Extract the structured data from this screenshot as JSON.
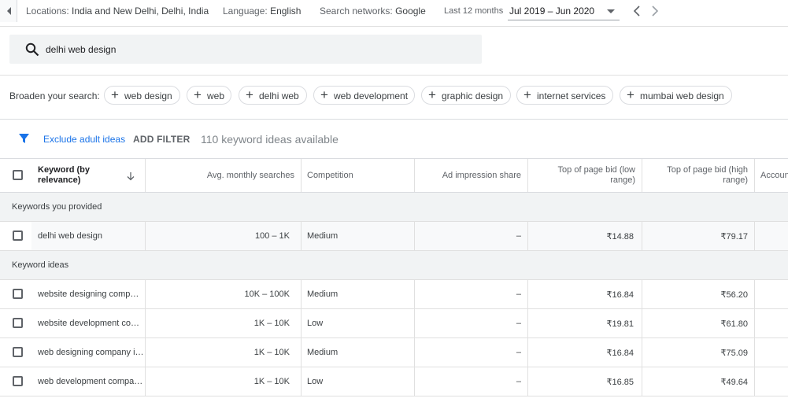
{
  "topbar": {
    "locations_label": "Locations:",
    "locations_value": "India and New Delhi, Delhi, India",
    "language_label": "Language:",
    "language_value": "English",
    "networks_label": "Search networks:",
    "networks_value": "Google",
    "period_label": "Last 12 months",
    "period_value": "Jul 2019 – Jun 2020"
  },
  "search": {
    "value": "delhi web design"
  },
  "broaden": {
    "label": "Broaden your search:",
    "chips": [
      "web design",
      "web",
      "delhi web",
      "web development",
      "graphic design",
      "internet services",
      "mumbai web design"
    ]
  },
  "filter": {
    "exclude_label": "Exclude adult ideas",
    "add_filter_label": "ADD FILTER",
    "count_text": "110 keyword ideas available"
  },
  "table": {
    "headers": {
      "keyword_line1": "Keyword (by",
      "keyword_line2": "relevance)",
      "avg_searches": "Avg. monthly searches",
      "competition": "Competition",
      "impression_share": "Ad impression share",
      "bid_low_line1": "Top of page bid (low",
      "bid_low_line2": "range)",
      "bid_high_line1": "Top of page bid (high",
      "bid_high_line2": "range)",
      "account": "Account status"
    },
    "groups": {
      "provided": "Keywords you provided",
      "ideas": "Keyword ideas"
    },
    "provided_rows": [
      {
        "keyword": "delhi web design",
        "searches": "100 – 1K",
        "competition": "Medium",
        "share": "–",
        "bid_low": "₹14.88",
        "bid_high": "₹79.17"
      }
    ],
    "idea_rows": [
      {
        "keyword": "website designing comp…",
        "searches": "10K – 100K",
        "competition": "Medium",
        "share": "–",
        "bid_low": "₹16.84",
        "bid_high": "₹56.20"
      },
      {
        "keyword": "website development co…",
        "searches": "1K – 10K",
        "competition": "Low",
        "share": "–",
        "bid_low": "₹19.81",
        "bid_high": "₹61.80"
      },
      {
        "keyword": "web designing company i…",
        "searches": "1K – 10K",
        "competition": "Medium",
        "share": "–",
        "bid_low": "₹16.84",
        "bid_high": "₹75.09"
      },
      {
        "keyword": "web development compa…",
        "searches": "1K – 10K",
        "competition": "Low",
        "share": "–",
        "bid_low": "₹16.85",
        "bid_high": "₹49.64"
      }
    ]
  },
  "colors": {
    "accent": "#1a73e8",
    "group_bg": "#f1f3f4",
    "border": "#dadce0"
  }
}
